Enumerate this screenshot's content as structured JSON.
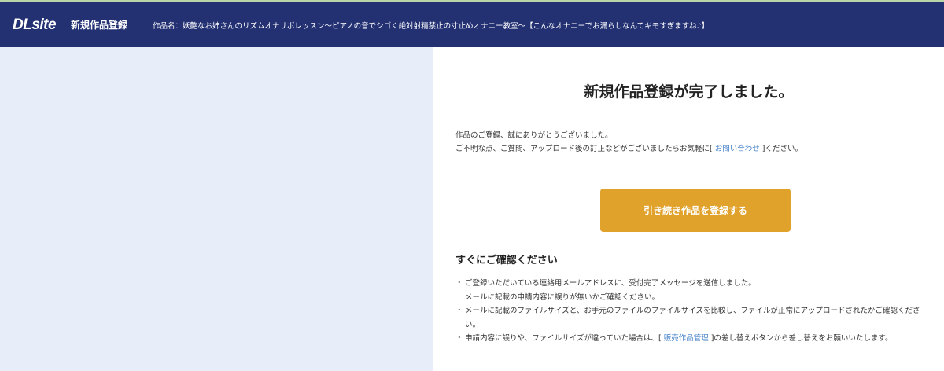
{
  "header": {
    "logo": "DLsite",
    "title": "新規作品登録",
    "work_name": "作品名：妖艶なお姉さんのリズムオナサポレッスン〜ピアノの音でシゴく絶対射精禁止の寸止めオナニー教室〜【こんなオナニーでお漏らしなんてキモすぎますね♪】"
  },
  "main": {
    "title": "新規作品登録が完了しました。",
    "thanks_line1": "作品のご登録、誠にありがとうございました。",
    "thanks_line2_pre": "ご不明な点、ご質問、アップロード後の訂正などがございましたらお気軽に[ ",
    "contact_link": "お問い合わせ",
    "thanks_line2_post": " ]ください。",
    "cta_label": "引き続き作品を登録する",
    "section_heading": "すぐにご確認ください",
    "bullet": "・",
    "note1_a": "ご登録いただいている連絡用メールアドレスに、受付完了メッセージを送信しました。",
    "note1_b": "メールに記載の申請内容に誤りが無いかご確認ください。",
    "note2_a": "メールに記載のファイルサイズと、お手元のファイルのファイルサイズを比較し、ファイルが正常にアップロードされたかご確認くださ",
    "note2_b": "い。",
    "note3_pre": "申請内容に誤りや、ファイルサイズが違っていた場合は、[ ",
    "sales_link": "販売作品管理",
    "note3_post": " ]の差し替えボタンから差し替えをお願いいたします。"
  },
  "colors": {
    "header_bg": "#233173",
    "left_pane_bg": "#e7edf9",
    "cta_bg": "#e1a22b",
    "link": "#3f7ec8"
  }
}
